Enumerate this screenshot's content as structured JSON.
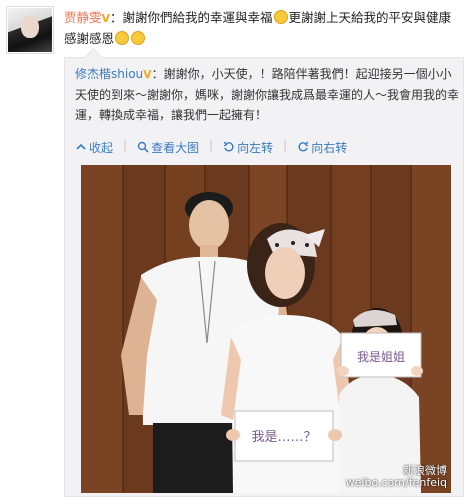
{
  "post": {
    "author": "贾静雯",
    "verified_badge": "V",
    "text_before_emoji": "：謝謝你們給我的幸運與幸福",
    "text_after_emoji": "更謝謝上天給我的平安與健康",
    "text_line2": "感謝感恩",
    "emoji_icon": "smile-face"
  },
  "repost": {
    "author": "修杰楷shiou",
    "verified_badge": "V",
    "text": "：謝謝你，小天使，！路陪伴著我們！起迎接另一個小小天使的到來～謝謝你，媽咪，謝謝你讓我成爲最幸運的人～我會用我的幸運，轉換成幸福，讓我們一起擁有！",
    "toolbar": {
      "collapse": "收起",
      "view_large": "查看大图",
      "rotate_left": "向左转",
      "rotate_right": "向右转"
    }
  },
  "photo": {
    "sign_adult": "我是……？",
    "sign_child": "我是姐姐",
    "watermark_line1": "新浪微博",
    "watermark_line2": "weibo.com/fenfeiq"
  },
  "colors": {
    "author_link": "#eb7350",
    "repost_link": "#3b7bbf",
    "repost_bg": "#f2f2f5",
    "wood_wall": "#6b3a1e"
  }
}
